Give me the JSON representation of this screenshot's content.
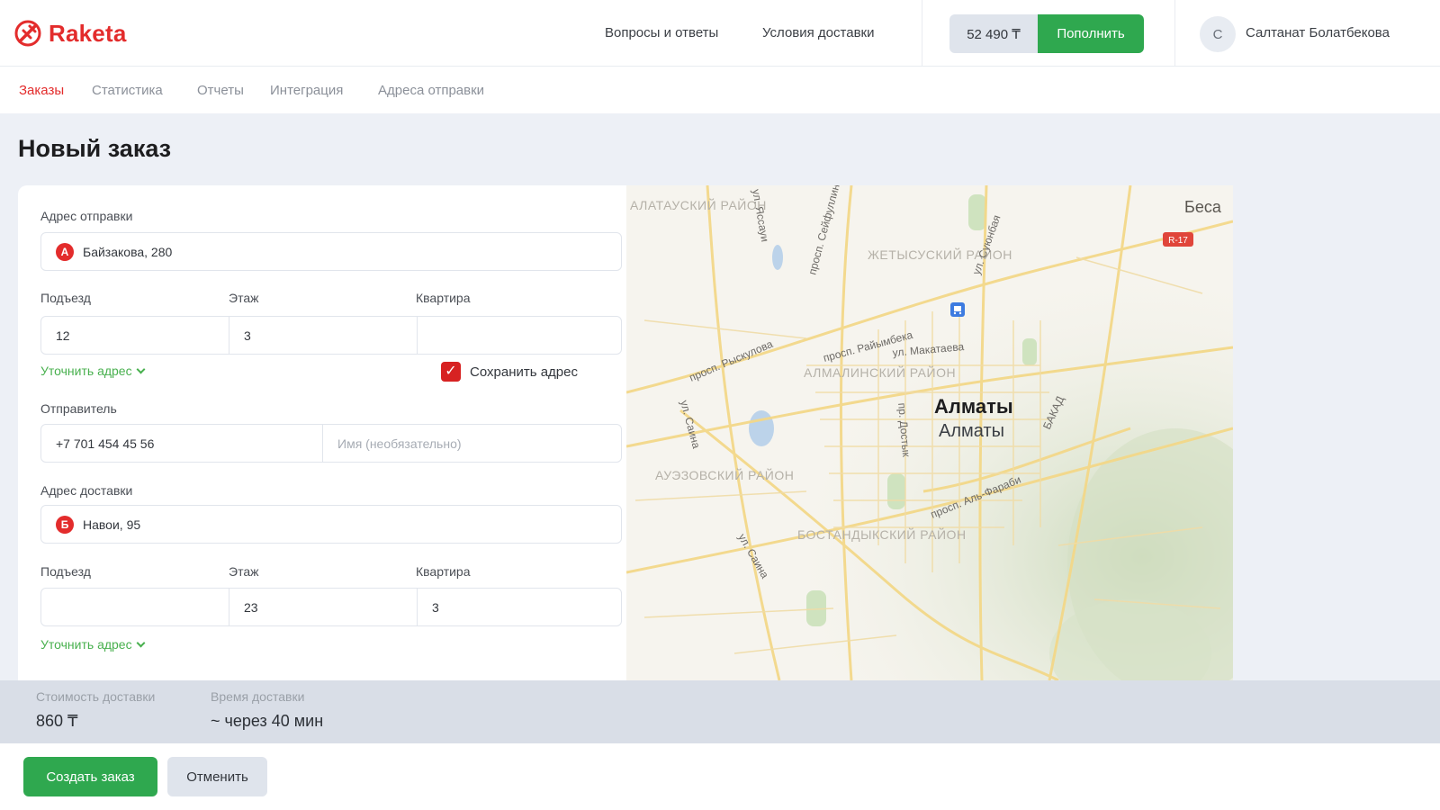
{
  "brand": {
    "name": "Raketa",
    "logo_icon": "rocket-logo-icon"
  },
  "header": {
    "links": [
      "Вопросы и ответы",
      "Условия доставки"
    ],
    "balance": "52 490 ₸",
    "topup_label": "Пополнить",
    "avatar_initial": "С",
    "user_name": "Салтанат Болатбекова"
  },
  "nav": {
    "tabs": [
      "Заказы",
      "Статистика",
      "Отчеты",
      "Интеграция",
      "Адреса отправки"
    ],
    "active": "Заказы"
  },
  "page": {
    "title": "Новый заказ"
  },
  "pickup": {
    "label": "Адрес отправки",
    "marker": "А",
    "address": "Байзакова, 280",
    "entrance_label": "Подъезд",
    "floor_label": "Этаж",
    "apt_label": "Квартира",
    "entrance": "12",
    "floor": "3",
    "apt": "",
    "refine_label": "Уточнить адрес",
    "save_label": "Сохранить адрес",
    "save_checked": true
  },
  "sender": {
    "label": "Отправитель",
    "phone": "+7 701 454 45 56",
    "name_placeholder": "Имя (необязательно)"
  },
  "delivery": {
    "label": "Адрес доставки",
    "marker": "Б",
    "address": "Навои, 95",
    "entrance_label": "Подъезд",
    "floor_label": "Этаж",
    "apt_label": "Квартира",
    "entrance": "",
    "floor": "23",
    "apt": "3",
    "refine_label": "Уточнить адрес"
  },
  "map": {
    "city": "Алматы",
    "city_sub": "Алматы",
    "districts": [
      "АЛАТАУСКИЙ РАЙОН",
      "ЖЕТЫСУСКИЙ РАЙОН",
      "АЛМАЛИНСКИЙ РАЙОН",
      "АУЭЗОВСКИЙ РАЙОН",
      "БОСТАНДЫКСКИЙ РАЙОН"
    ],
    "streets": [
      "просп. Рыскулова",
      "просп. Райымбека",
      "ул. Макатаева",
      "просп. Аль-Фараби",
      "ул. Саина",
      "ул. Саина",
      "просп. Сейфуллина",
      "ул. Яссауи",
      "пр. Достык",
      "БАКАД",
      "ул. Суюнбая"
    ],
    "corner_text": "Беса",
    "shield": "R-17",
    "poi_icon": "bus-station-icon"
  },
  "summary": {
    "cost_label": "Стоимость доставки",
    "cost": "860 ₸",
    "time_label": "Время доставки",
    "time": "~ через 40 мин"
  },
  "actions": {
    "create": "Создать заказ",
    "cancel": "Отменить"
  }
}
